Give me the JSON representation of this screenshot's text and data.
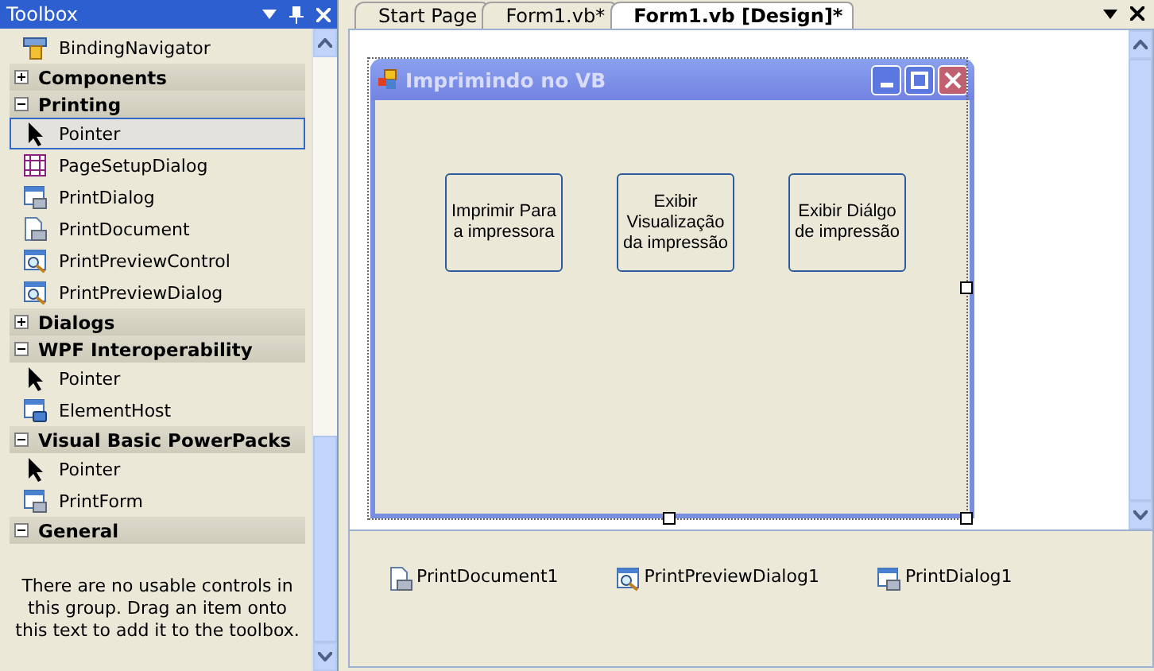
{
  "toolbox": {
    "title": "Toolbox",
    "rows": [
      {
        "kind": "item",
        "label": "BindingNavigator",
        "selected": false
      },
      {
        "kind": "group",
        "label": "Components",
        "expanded": false
      },
      {
        "kind": "group",
        "label": "Printing",
        "expanded": true
      },
      {
        "kind": "item",
        "label": "Pointer",
        "selected": true
      },
      {
        "kind": "item",
        "label": "PageSetupDialog",
        "selected": false
      },
      {
        "kind": "item",
        "label": "PrintDialog",
        "selected": false
      },
      {
        "kind": "item",
        "label": "PrintDocument",
        "selected": false
      },
      {
        "kind": "item",
        "label": "PrintPreviewControl",
        "selected": false
      },
      {
        "kind": "item",
        "label": "PrintPreviewDialog",
        "selected": false
      },
      {
        "kind": "group",
        "label": "Dialogs",
        "expanded": false
      },
      {
        "kind": "group",
        "label": "WPF Interoperability",
        "expanded": true
      },
      {
        "kind": "item",
        "label": "Pointer",
        "selected": false
      },
      {
        "kind": "item",
        "label": "ElementHost",
        "selected": false
      },
      {
        "kind": "group",
        "label": "Visual Basic PowerPacks",
        "expanded": true
      },
      {
        "kind": "item",
        "label": "Pointer",
        "selected": false
      },
      {
        "kind": "item",
        "label": "PrintForm",
        "selected": false
      },
      {
        "kind": "group",
        "label": "General",
        "expanded": true
      }
    ],
    "empty_message": "There are no usable controls in this group. Drag an item onto this text to add it to the toolbox."
  },
  "tabs": [
    {
      "label": "Start Page",
      "selected": false
    },
    {
      "label": "Form1.vb*",
      "selected": false
    },
    {
      "label": "Form1.vb [Design]*",
      "selected": true
    }
  ],
  "form": {
    "title": "Imprimindo no VB",
    "buttons": [
      "Imprimir Para a impressora",
      "Exibir Visualização da impressão",
      "Exibir Diálgo de impressão"
    ]
  },
  "tray": [
    "PrintDocument1",
    "PrintPreviewDialog1",
    "PrintDialog1"
  ]
}
